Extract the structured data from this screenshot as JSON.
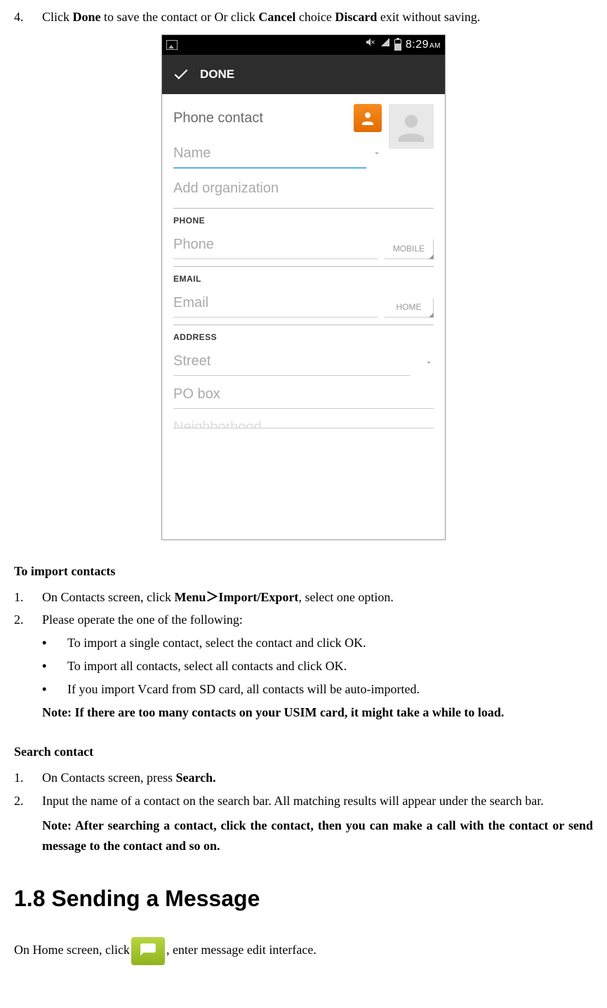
{
  "step4": {
    "number": "4.",
    "pre": "Click ",
    "done": "Done",
    "mid1": " to save the contact or Or click ",
    "cancel": "Cancel",
    "mid2": " choice ",
    "discard": "Discard",
    "post": " exit without saving."
  },
  "phone": {
    "time": "8:29",
    "ampm": "AM",
    "done_bar": "DONE",
    "phone_contact": "Phone contact",
    "name": "Name",
    "add_org": "Add organization",
    "section_phone": "PHONE",
    "phone_field": "Phone",
    "phone_type": "MOBILE",
    "section_email": "EMAIL",
    "email_field": "Email",
    "email_type": "HOME",
    "section_address": "ADDRESS",
    "street": "Street",
    "pobox": "PO box",
    "neighborhood": "Neighborhood"
  },
  "import": {
    "heading": "To import contacts",
    "item1_num": "1.",
    "item1_pre": "On Contacts screen, click ",
    "item1_bold": "Menu＞Import/Export",
    "item1_post": ", select one option.",
    "item2_num": "2.",
    "item2_text": "Please operate the one of the following:",
    "bullet1": "To import a single contact, select the contact and click OK.",
    "bullet2": "To import all contacts, select all contacts and click OK.",
    "bullet3": "If you import Vcard from SD card, all contacts will be auto-imported.",
    "note": "Note: If there are too many contacts on your USIM card, it might take a while to load."
  },
  "search": {
    "heading": "Search contact",
    "item1_num": "1.",
    "item1_pre": "On Contacts screen, press ",
    "item1_bold": "Search.",
    "item2_num": "2.",
    "item2_text": "Input the name of a contact on the search bar. All matching results will appear under the search bar.",
    "note": "Note: After searching a contact, click the contact, then you can make a call with the contact or send message to the contact and so on."
  },
  "section18": {
    "heading": "1.8 Sending a Message",
    "pre": "On Home screen, click",
    "post": ", enter message edit interface."
  }
}
